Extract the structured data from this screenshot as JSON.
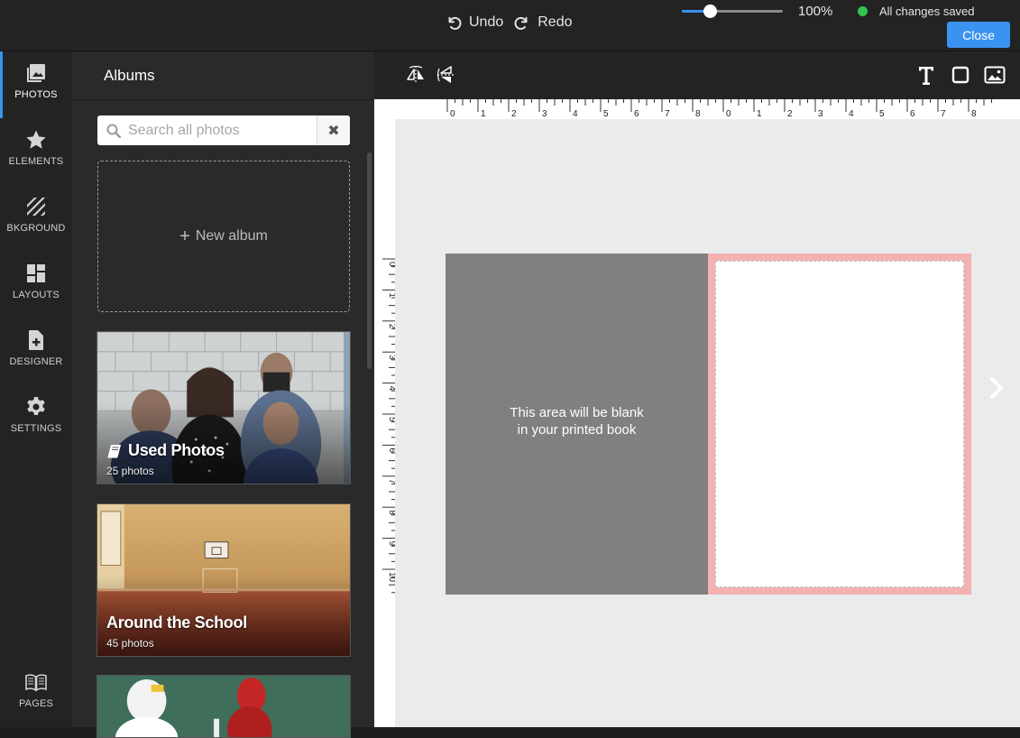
{
  "topbar": {
    "undo_label": "Undo",
    "redo_label": "Redo",
    "zoom_value": "100%",
    "zoom_fraction": 0.28,
    "save_status": "All changes saved",
    "status_color": "#31c44f",
    "close_label": "Close",
    "accent_color": "#3a93f0"
  },
  "nav": {
    "items": [
      {
        "label": "PHOTOS",
        "icon": "photos-icon",
        "active": true
      },
      {
        "label": "ELEMENTS",
        "icon": "star-icon"
      },
      {
        "label": "BKGROUND",
        "icon": "background-stripes-icon"
      },
      {
        "label": "LAYOUTS",
        "icon": "layouts-grid-icon"
      },
      {
        "label": "DESIGNER",
        "icon": "designer-doc-plus-icon"
      },
      {
        "label": "SETTINGS",
        "icon": "gear-icon"
      }
    ],
    "pages_label": "PAGES"
  },
  "albums": {
    "title": "Albums",
    "search_placeholder": "Search all photos",
    "new_album_label": "New album",
    "items": [
      {
        "name": "Used Photos",
        "count": "25 photos",
        "icon": "book-icon"
      },
      {
        "name": "Around the School",
        "count": "45 photos"
      },
      {
        "name": "",
        "count": ""
      }
    ]
  },
  "editor": {
    "toolbar_icons": [
      "flip-horizontal-icon",
      "flip-vertical-icon",
      "text-tool-icon",
      "shape-tool-icon",
      "image-tool-icon"
    ],
    "ruler_top_labels": [
      "0",
      "1",
      "2",
      "3",
      "4",
      "5",
      "6",
      "7",
      "8",
      "0",
      "1",
      "2",
      "3",
      "4",
      "5",
      "6",
      "7",
      "8"
    ],
    "ruler_left_labels": [
      "0",
      "1",
      "2",
      "3",
      "4",
      "5",
      "6",
      "7",
      "8",
      "9",
      "10"
    ],
    "left_page_text": "This area will be blank in your printed book",
    "right_page_border_color": "#f4b1b1"
  }
}
